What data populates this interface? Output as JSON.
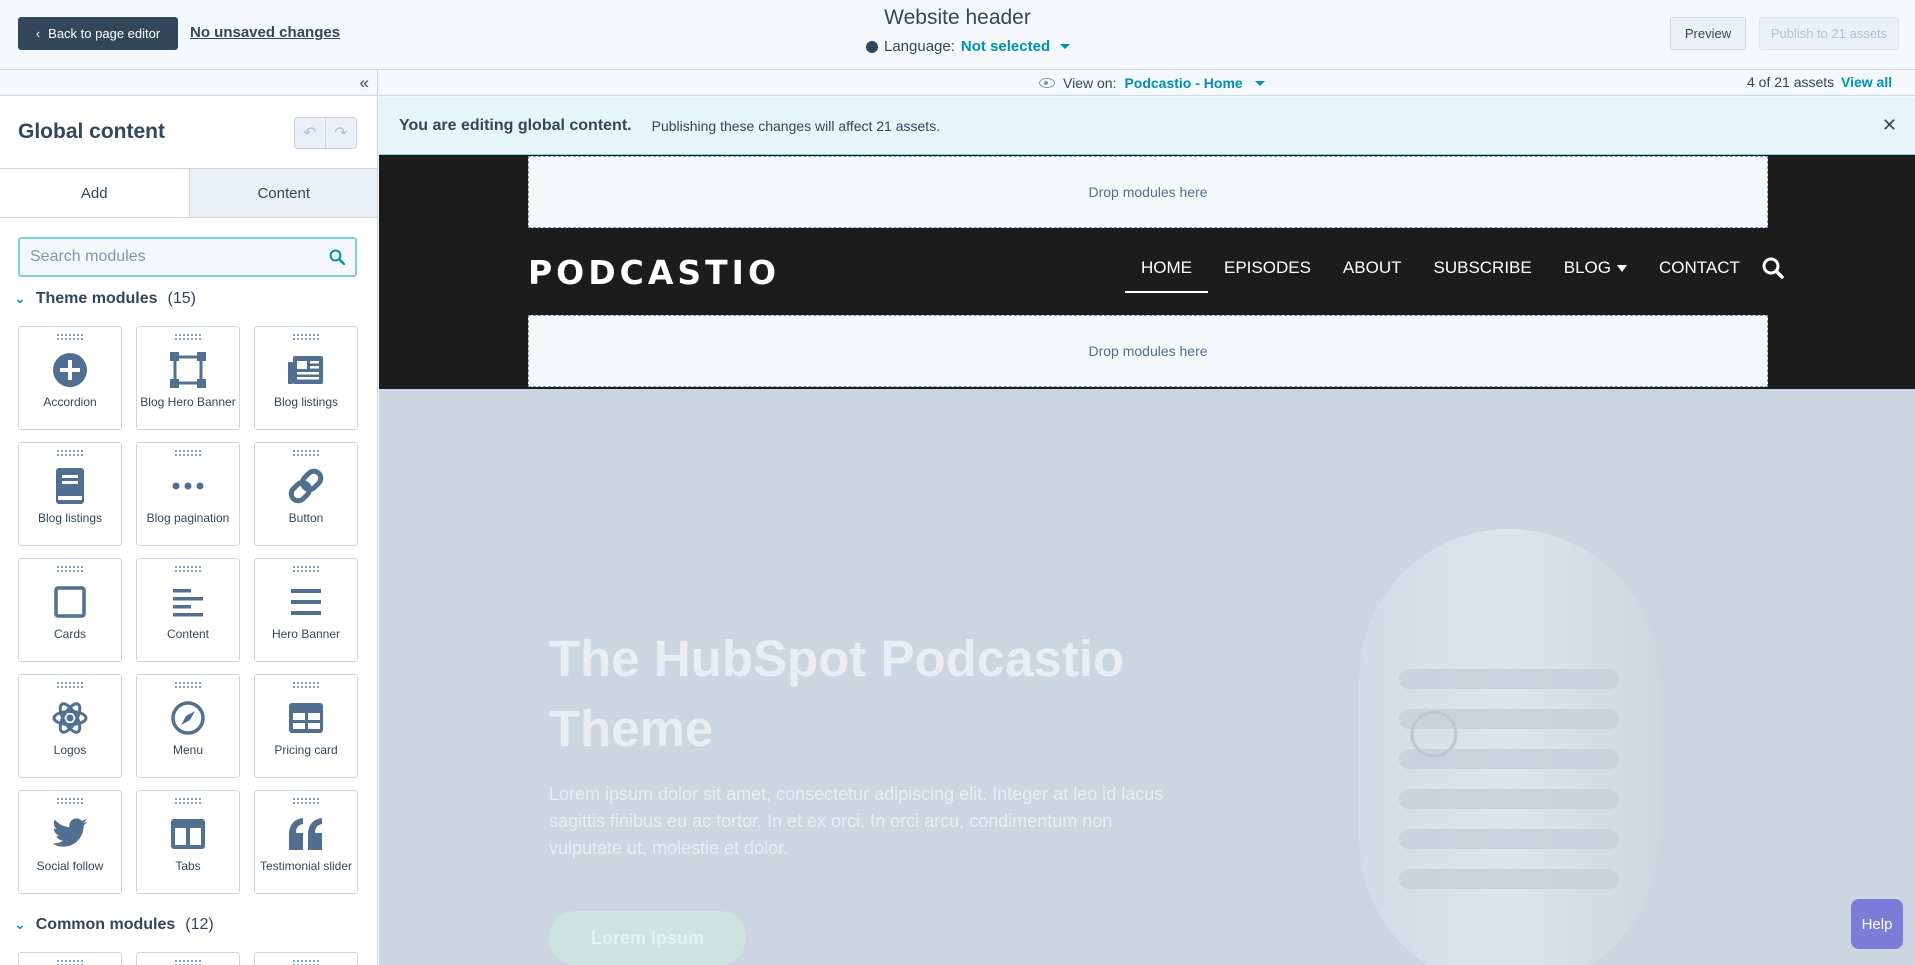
{
  "topbar": {
    "back_label": "Back to page editor",
    "unsaved_label": "No unsaved changes",
    "page_title": "Website header",
    "language_label": "Language:",
    "language_value": "Not selected",
    "preview_label": "Preview",
    "publish_label": "Publish to 21 assets"
  },
  "sidebar": {
    "title": "Global content",
    "tabs": [
      {
        "label": "Add"
      },
      {
        "label": "Content"
      }
    ],
    "search": {
      "placeholder": "Search modules",
      "value": ""
    },
    "theme_section": {
      "name": "Theme modules",
      "count": "(15)"
    },
    "common_section": {
      "name": "Common modules",
      "count": "(12)"
    },
    "modules": [
      {
        "label": "Accordion",
        "icon": "plus-circle-icon"
      },
      {
        "label": "Blog Hero Banner",
        "icon": "crop-frame-icon"
      },
      {
        "label": "Blog listings",
        "icon": "newspaper-icon"
      },
      {
        "label": "Blog listings",
        "icon": "book-icon"
      },
      {
        "label": "Blog pagination",
        "icon": "ellipsis-icon"
      },
      {
        "label": "Button",
        "icon": "link-icon"
      },
      {
        "label": "Cards",
        "icon": "square-icon"
      },
      {
        "label": "Content",
        "icon": "align-left-icon"
      },
      {
        "label": "Hero Banner",
        "icon": "hamburger-lines-icon"
      },
      {
        "label": "Logos",
        "icon": "atom-icon"
      },
      {
        "label": "Menu",
        "icon": "compass-icon"
      },
      {
        "label": "Pricing card",
        "icon": "table-icon"
      },
      {
        "label": "Social follow",
        "icon": "twitter-icon"
      },
      {
        "label": "Tabs",
        "icon": "columns-icon"
      },
      {
        "label": "Testimonial slider",
        "icon": "quote-icon"
      }
    ]
  },
  "viewbar": {
    "view_on_label": "View on:",
    "view_on_value": "Podcastio - Home",
    "assets_count": "4 of 21 assets",
    "view_all": "View all"
  },
  "banner": {
    "bold": "You are editing global content.",
    "text": "Publishing these changes will affect 21 assets."
  },
  "header_preview": {
    "dropzone_label": "Drop modules here",
    "logo_text": "PODCASTIO",
    "nav": [
      "HOME",
      "EPISODES",
      "ABOUT",
      "SUBSCRIBE",
      "BLOG",
      "CONTACT"
    ]
  },
  "hero": {
    "title": "The HubSpot Podcastio Theme",
    "text": "Lorem ipsum dolor sit amet, consectetur adipiscing elit. Integer at leo id lacus sagittis finibus eu ac tortor. In et ex orci. In orci arcu, condimentum non vulputate ut, molestie et dolor.",
    "button": "Lorem Ipsum"
  },
  "help_label": "Help",
  "colors": {
    "accent": "#0091ae",
    "dark": "#33475b",
    "header_bg": "#1c1c1c"
  }
}
